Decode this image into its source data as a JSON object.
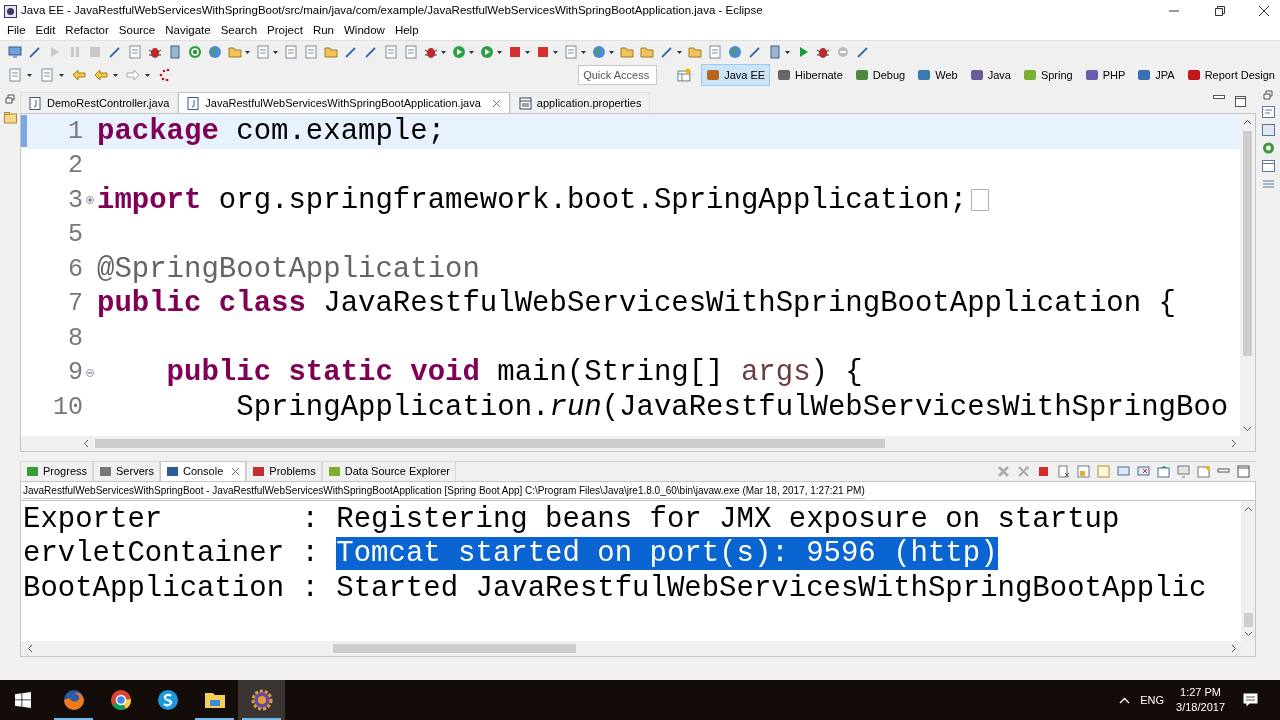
{
  "window": {
    "title": "Java EE - JavaRestfulWebServicesWithSpringBoot/src/main/java/com/example/JavaRestfulWebServicesWithSpringBootApplication.java - Eclipse"
  },
  "menu": [
    "File",
    "Edit",
    "Refactor",
    "Source",
    "Navigate",
    "Search",
    "Project",
    "Run",
    "Window",
    "Help"
  ],
  "quick_access": {
    "placeholder": "Quick Access"
  },
  "perspectives": [
    {
      "label": "Java EE",
      "selected": true
    },
    {
      "label": "Hibernate",
      "selected": false
    },
    {
      "label": "Debug",
      "selected": false
    },
    {
      "label": "Web",
      "selected": false
    },
    {
      "label": "Java",
      "selected": false
    },
    {
      "label": "Spring",
      "selected": false
    },
    {
      "label": "PHP",
      "selected": false
    },
    {
      "label": "JPA",
      "selected": false
    },
    {
      "label": "Report Design",
      "selected": false
    }
  ],
  "editor": {
    "tabs": [
      {
        "label": "DemoRestController.java",
        "selected": false,
        "kind": "java"
      },
      {
        "label": "JavaRestfulWebServicesWithSpringBootApplication.java",
        "selected": true,
        "kind": "java"
      },
      {
        "label": "application.properties",
        "selected": false,
        "kind": "properties"
      }
    ],
    "lines": [
      {
        "number": "1",
        "current": true,
        "segments": [
          {
            "kind": "keyword",
            "text": "package"
          },
          {
            "kind": "plain",
            "text": " com.example;"
          }
        ]
      },
      {
        "number": "2",
        "current": false
      },
      {
        "number": "3",
        "current": false,
        "collapsed": true,
        "segments": [
          {
            "kind": "keyword",
            "text": "import"
          },
          {
            "kind": "plain",
            "text": " org.springframework.boot.SpringApplication;"
          }
        ]
      },
      {
        "number": "5",
        "current": false
      },
      {
        "number": "6",
        "current": false,
        "segments": [
          {
            "kind": "annotation",
            "text": "@SpringBootApplication"
          }
        ]
      },
      {
        "number": "7",
        "current": false,
        "segments": [
          {
            "kind": "keyword",
            "text": "public class"
          },
          {
            "kind": "plain",
            "text": " JavaRestfulWebServicesWithSpringBootApplication {"
          }
        ]
      },
      {
        "number": "8",
        "current": false
      },
      {
        "number": "9",
        "current": false,
        "collapsed": false,
        "segments": [
          {
            "kind": "keyword",
            "text": "    public static void"
          },
          {
            "kind": "plain",
            "text": " main(String[] "
          },
          {
            "kind": "parameter",
            "text": "args"
          },
          {
            "kind": "plain",
            "text": ") {"
          }
        ]
      },
      {
        "number": "10",
        "current": false,
        "segments": [
          {
            "kind": "plain",
            "text": "        SpringApplication."
          },
          {
            "kind": "method",
            "text": "run"
          },
          {
            "kind": "plain",
            "text": "(JavaRestfulWebServicesWithSpringBoo"
          }
        ]
      }
    ]
  },
  "console": {
    "tabs": [
      {
        "label": "Progress",
        "selected": false
      },
      {
        "label": "Servers",
        "selected": false
      },
      {
        "label": "Console",
        "selected": true
      },
      {
        "label": "Problems",
        "selected": false
      },
      {
        "label": "Data Source Explorer",
        "selected": false
      }
    ],
    "header": "JavaRestfulWebServicesWithSpringBoot - JavaRestfulWebServicesWithSpringBootApplication [Spring Boot App] C:\\Program Files\\Java\\jre1.8.0_60\\bin\\javaw.exe (Mar 18, 2017, 1:27:21 PM)",
    "lines": [
      {
        "segments": [
          {
            "text": "Exporter        : Registering beans for JMX exposure on startup",
            "selected": false
          }
        ]
      },
      {
        "segments": [
          {
            "text": "ervletContainer : ",
            "selected": false
          },
          {
            "text": "Tomcat started on port(s): 9596 (http)",
            "selected": true
          }
        ]
      },
      {
        "segments": [
          {
            "text": "BootApplication : Started JavaRestfulWebServicesWithSpringBootApplic",
            "selected": false
          }
        ]
      }
    ]
  },
  "taskbar": {
    "apps": [
      {
        "kind": "fox",
        "running": true,
        "active": false
      },
      {
        "kind": "ring",
        "running": false,
        "active": false
      },
      {
        "kind": "s",
        "running": false,
        "active": false
      },
      {
        "kind": "folder",
        "running": true,
        "active": false
      },
      {
        "kind": "gear",
        "running": true,
        "active": true
      }
    ],
    "language": "ENG",
    "time": "1:27 PM",
    "date": "3/18/2017"
  }
}
